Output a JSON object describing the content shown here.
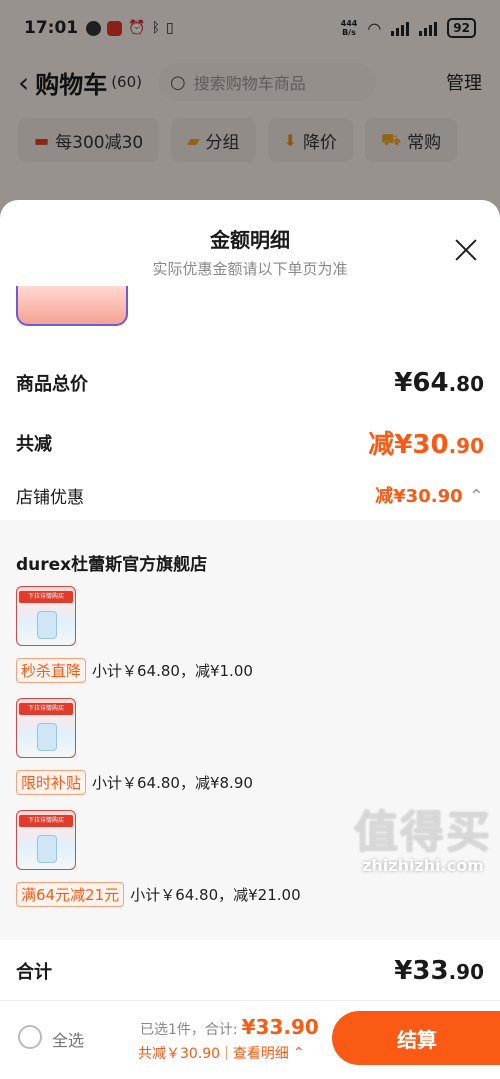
{
  "status": {
    "time": "17:01",
    "net_speed_top": "444",
    "net_speed_bottom": "B/s",
    "battery": "92"
  },
  "header": {
    "title": "购物车",
    "count": "(60)",
    "search_placeholder": "搜索购物车商品",
    "manage": "管理"
  },
  "chips": [
    {
      "label": "每300减30",
      "icon": "shop-icon"
    },
    {
      "label": "分组",
      "icon": "folder-icon"
    },
    {
      "label": "降价",
      "icon": "price-drop-icon"
    },
    {
      "label": "常购",
      "icon": "cart-icon"
    }
  ],
  "sheet": {
    "title": "金额明细",
    "subtitle": "实际优惠金额请以下单页为准",
    "total_price_label": "商品总价",
    "total_price_int": "¥64",
    "total_price_dec": ".80",
    "discount_label": "共减",
    "discount_int": "减¥30",
    "discount_dec": ".90",
    "store_discount_label": "店铺优惠",
    "store_discount_value": "减¥30.90",
    "shop_name": "durex杜蕾斯官方旗舰店",
    "product_image_banner": "下拉详情购买",
    "deals": [
      {
        "tag": "秒杀直降",
        "text": "小计￥64.80，减¥1.00"
      },
      {
        "tag": "限时补贴",
        "text": "小计￥64.80，减¥8.90"
      },
      {
        "tag": "满64元减21元",
        "text": "小计￥64.80，减¥21.00"
      }
    ],
    "sum_label": "合计",
    "sum_int": "¥33",
    "sum_dec": ".90"
  },
  "bottom": {
    "select_all": "全选",
    "selected_info": "已选1件，合计:",
    "selected_total": "¥33.90",
    "saved": "共减￥30.90",
    "separator": "|",
    "view_detail": "查看明细",
    "checkout": "结算",
    "watermark_big": "值得买",
    "watermark_small": "zhizhizhi.com"
  },
  "colors": {
    "accent": "#fa5a14",
    "tag_border": "#f7a07a"
  }
}
